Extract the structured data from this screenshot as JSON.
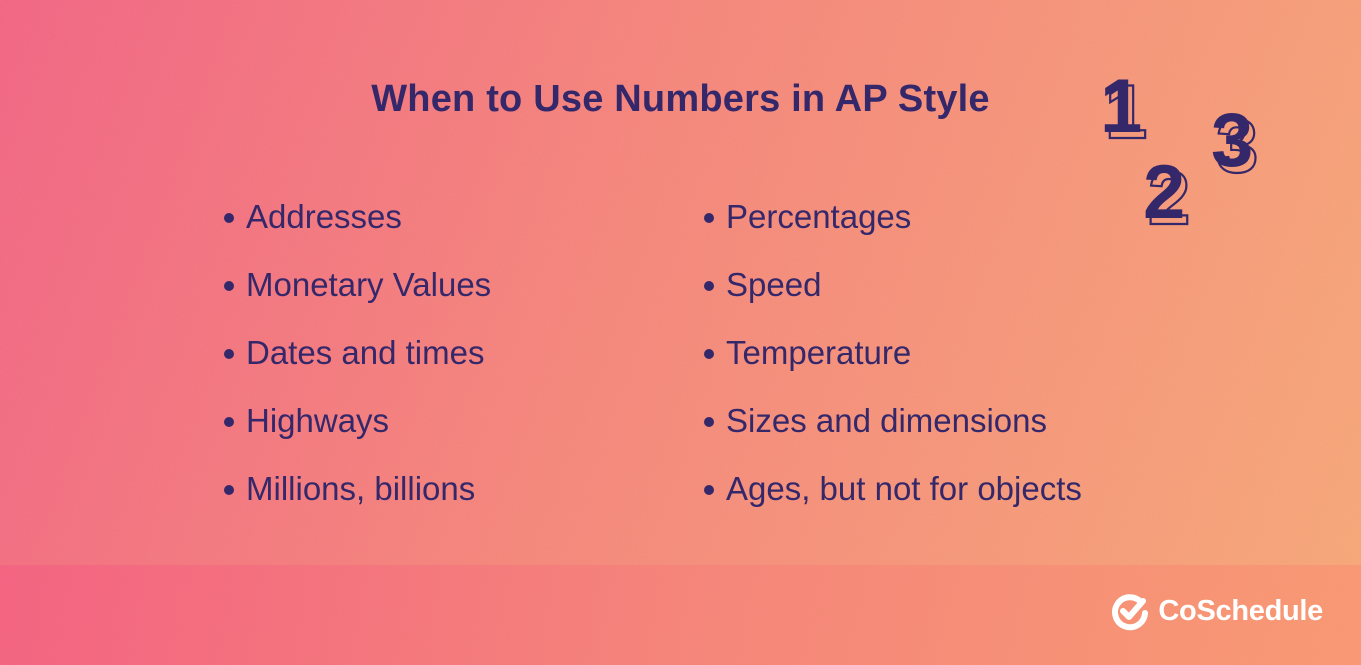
{
  "title": "When to Use Numbers in AP Style",
  "left_items": [
    "Addresses",
    "Monetary Values",
    "Dates and times",
    "Highways",
    "Millions, billions"
  ],
  "right_items": [
    "Percentages",
    "Speed",
    "Temperature",
    "Sizes and dimensions",
    "Ages, but not for objects"
  ],
  "decor_digits": [
    "1",
    "2",
    "3"
  ],
  "brand": {
    "name": "CoSchedule",
    "icon": "coschedule-check-logo-icon"
  },
  "colors": {
    "text": "#34286a",
    "gradient_start": "#f46483",
    "gradient_end": "#f9a877",
    "logo": "#ffffff"
  }
}
